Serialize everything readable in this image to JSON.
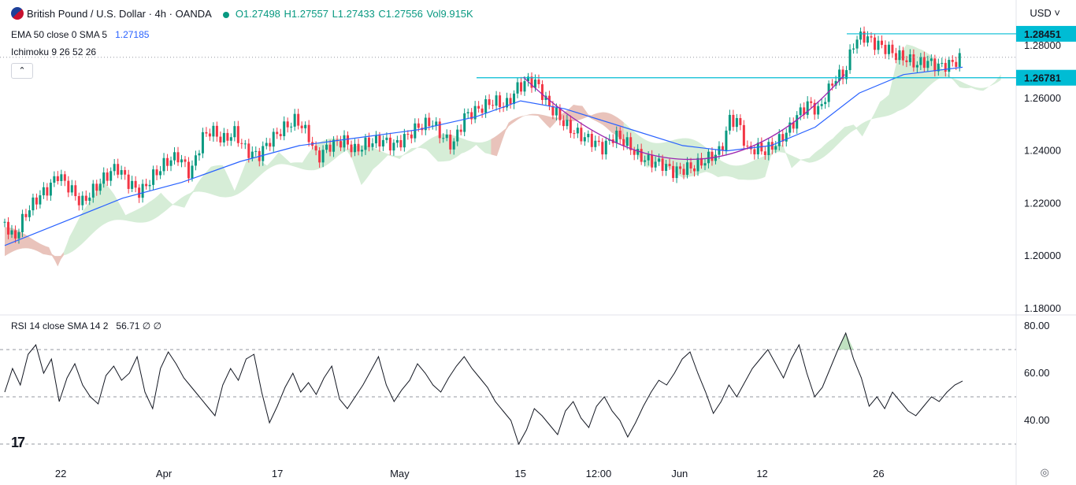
{
  "header": {
    "symbol": "British Pound / U.S. Dollar · 4h · OANDA",
    "open": "O1.27498",
    "high": "H1.27557",
    "low": "L1.27433",
    "close": "C1.27556",
    "volume": "Vol9.915K",
    "currency": "USD",
    "currency_chevron": "chevron-down-icon"
  },
  "indicators": {
    "ema_label": "EMA 50 close 0 SMA 5",
    "ema_value": "1.27185",
    "ichimoku_label": "Ichimoku 9 26 52 26",
    "rsi_label": "RSI 14 close SMA 14 2",
    "rsi_value": "56.71",
    "rsi_extra": "∅ ∅"
  },
  "colors": {
    "up": "#089981",
    "down": "#f23645",
    "ema": "#2962ff",
    "cloud_bull": "#a5d6a7",
    "cloud_bear": "#faa1a4",
    "level": "#00bcd4",
    "curve": "#9c27b0",
    "rsi": "#131722"
  },
  "chart_data": [
    {
      "type": "candlestick",
      "title": "British Pound / U.S. Dollar · 4h · OANDA",
      "ylim": [
        1.17,
        1.29
      ],
      "y_ticks": [
        "1.28000",
        "1.26000",
        "1.24000",
        "1.22000",
        "1.20000",
        "1.18000"
      ],
      "x_ticks": [
        "22",
        "Apr",
        "17",
        "May",
        "15",
        "12:00",
        "Jun",
        "12",
        "26"
      ],
      "price_levels": [
        {
          "label": "1.28451",
          "value": 1.28451
        },
        {
          "label": "1.26781",
          "value": 1.26781
        }
      ],
      "approx_close_path": [
        [
          0,
          1.213
        ],
        [
          6,
          1.206
        ],
        [
          14,
          1.216
        ],
        [
          22,
          1.222
        ],
        [
          30,
          1.226
        ],
        [
          36,
          1.231
        ],
        [
          44,
          1.226
        ],
        [
          52,
          1.22
        ],
        [
          60,
          1.225
        ],
        [
          68,
          1.23
        ],
        [
          76,
          1.234
        ],
        [
          84,
          1.228
        ],
        [
          92,
          1.224
        ],
        [
          100,
          1.23
        ],
        [
          110,
          1.236
        ],
        [
          118,
          1.238
        ],
        [
          126,
          1.231
        ],
        [
          134,
          1.245
        ],
        [
          140,
          1.248
        ],
        [
          148,
          1.244
        ],
        [
          156,
          1.247
        ],
        [
          164,
          1.24
        ],
        [
          172,
          1.238
        ],
        [
          180,
          1.244
        ],
        [
          190,
          1.249
        ],
        [
          198,
          1.252
        ],
        [
          206,
          1.246
        ],
        [
          212,
          1.237
        ],
        [
          220,
          1.242
        ],
        [
          230,
          1.244
        ],
        [
          238,
          1.24
        ],
        [
          246,
          1.243
        ],
        [
          256,
          1.244
        ],
        [
          264,
          1.242
        ],
        [
          272,
          1.245
        ],
        [
          280,
          1.249
        ],
        [
          290,
          1.251
        ],
        [
          296,
          1.246
        ],
        [
          304,
          1.242
        ],
        [
          312,
          1.253
        ],
        [
          322,
          1.256
        ],
        [
          332,
          1.259
        ],
        [
          340,
          1.257
        ],
        [
          348,
          1.264
        ],
        [
          356,
          1.267
        ],
        [
          362,
          1.265
        ],
        [
          368,
          1.258
        ],
        [
          376,
          1.253
        ],
        [
          382,
          1.249
        ],
        [
          390,
          1.246
        ],
        [
          398,
          1.244
        ],
        [
          406,
          1.241
        ],
        [
          414,
          1.246
        ],
        [
          422,
          1.243
        ],
        [
          430,
          1.238
        ],
        [
          438,
          1.236
        ],
        [
          446,
          1.235
        ],
        [
          454,
          1.232
        ],
        [
          460,
          1.233
        ],
        [
          468,
          1.234
        ],
        [
          474,
          1.236
        ],
        [
          480,
          1.238
        ],
        [
          486,
          1.24
        ],
        [
          492,
          1.252
        ],
        [
          498,
          1.251
        ],
        [
          504,
          1.24
        ],
        [
          510,
          1.241
        ],
        [
          516,
          1.24
        ],
        [
          524,
          1.243
        ],
        [
          532,
          1.248
        ],
        [
          540,
          1.255
        ],
        [
          546,
          1.258
        ],
        [
          552,
          1.255
        ],
        [
          558,
          1.262
        ],
        [
          564,
          1.268
        ],
        [
          570,
          1.269
        ],
        [
          576,
          1.281
        ],
        [
          582,
          1.284
        ],
        [
          590,
          1.281
        ],
        [
          598,
          1.279
        ],
        [
          606,
          1.276
        ],
        [
          612,
          1.275
        ],
        [
          618,
          1.273
        ],
        [
          626,
          1.274
        ],
        [
          634,
          1.272
        ],
        [
          642,
          1.273
        ],
        [
          650,
          1.2756
        ]
      ],
      "ema50_path": [
        [
          0,
          1.204
        ],
        [
          40,
          1.213
        ],
        [
          80,
          1.222
        ],
        [
          120,
          1.228
        ],
        [
          160,
          1.236
        ],
        [
          200,
          1.242
        ],
        [
          240,
          1.245
        ],
        [
          280,
          1.248
        ],
        [
          320,
          1.253
        ],
        [
          350,
          1.259
        ],
        [
          380,
          1.256
        ],
        [
          420,
          1.249
        ],
        [
          460,
          1.242
        ],
        [
          490,
          1.24
        ],
        [
          520,
          1.242
        ],
        [
          550,
          1.249
        ],
        [
          580,
          1.262
        ],
        [
          610,
          1.269
        ],
        [
          650,
          1.2718
        ]
      ]
    },
    {
      "type": "line",
      "title": "RSI 14 close SMA 14 2",
      "ylim": [
        25,
        85
      ],
      "y_ticks": [
        "80.00",
        "60.00",
        "40.00"
      ],
      "bands": [
        70,
        50,
        30
      ],
      "last_value": 56.71,
      "values": [
        52,
        62,
        55,
        68,
        72,
        60,
        66,
        48,
        58,
        64,
        55,
        50,
        47,
        59,
        63,
        57,
        60,
        67,
        52,
        45,
        62,
        69,
        64,
        58,
        54,
        50,
        46,
        42,
        55,
        62,
        57,
        66,
        68,
        52,
        39,
        46,
        54,
        60,
        52,
        56,
        51,
        58,
        63,
        49,
        45,
        50,
        55,
        61,
        67,
        55,
        48,
        53,
        57,
        64,
        60,
        55,
        52,
        58,
        63,
        67,
        62,
        58,
        54,
        48,
        44,
        40,
        30,
        36,
        45,
        42,
        38,
        34,
        44,
        48,
        41,
        37,
        46,
        50,
        44,
        40,
        33,
        39,
        46,
        52,
        57,
        55,
        60,
        66,
        69,
        60,
        52,
        43,
        48,
        55,
        50,
        56,
        62,
        66,
        70,
        64,
        58,
        66,
        72,
        60,
        50,
        54,
        62,
        70,
        77,
        66,
        58,
        46,
        50,
        45,
        52,
        48,
        44,
        42,
        46,
        50,
        48,
        52,
        55,
        56.71
      ]
    }
  ]
}
